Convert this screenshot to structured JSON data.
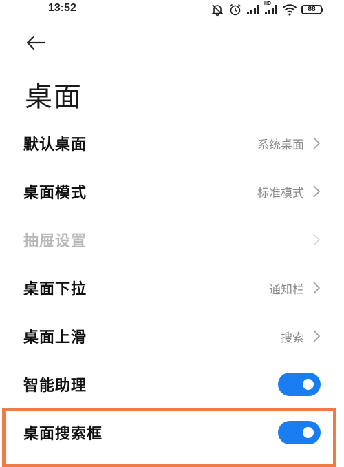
{
  "status_bar": {
    "time": "13:52",
    "network_label": "HD",
    "battery": "88",
    "icons": [
      "mute-icon",
      "alarm-icon",
      "signal-icon",
      "signal-hd-icon",
      "wifi-icon",
      "battery-icon"
    ]
  },
  "header": {
    "back_icon": "arrow-left-icon",
    "title": "桌面"
  },
  "settings": [
    {
      "label": "默认桌面",
      "value": "系统桌面",
      "type": "link",
      "enabled": true
    },
    {
      "label": "桌面模式",
      "value": "标准模式",
      "type": "link",
      "enabled": true
    },
    {
      "label": "抽屉设置",
      "value": "",
      "type": "link",
      "enabled": false
    },
    {
      "label": "桌面下拉",
      "value": "通知栏",
      "type": "link",
      "enabled": true
    },
    {
      "label": "桌面上滑",
      "value": "搜索",
      "type": "link",
      "enabled": true
    },
    {
      "label": "智能助理",
      "type": "toggle",
      "on": true,
      "enabled": true
    },
    {
      "label": "桌面搜索框",
      "type": "toggle",
      "on": true,
      "enabled": true
    }
  ],
  "colors": {
    "accent": "#1a7ef2",
    "highlight": "#f07b45",
    "disabled_text": "#b9b9b9",
    "value_text": "#8a8a8a"
  }
}
